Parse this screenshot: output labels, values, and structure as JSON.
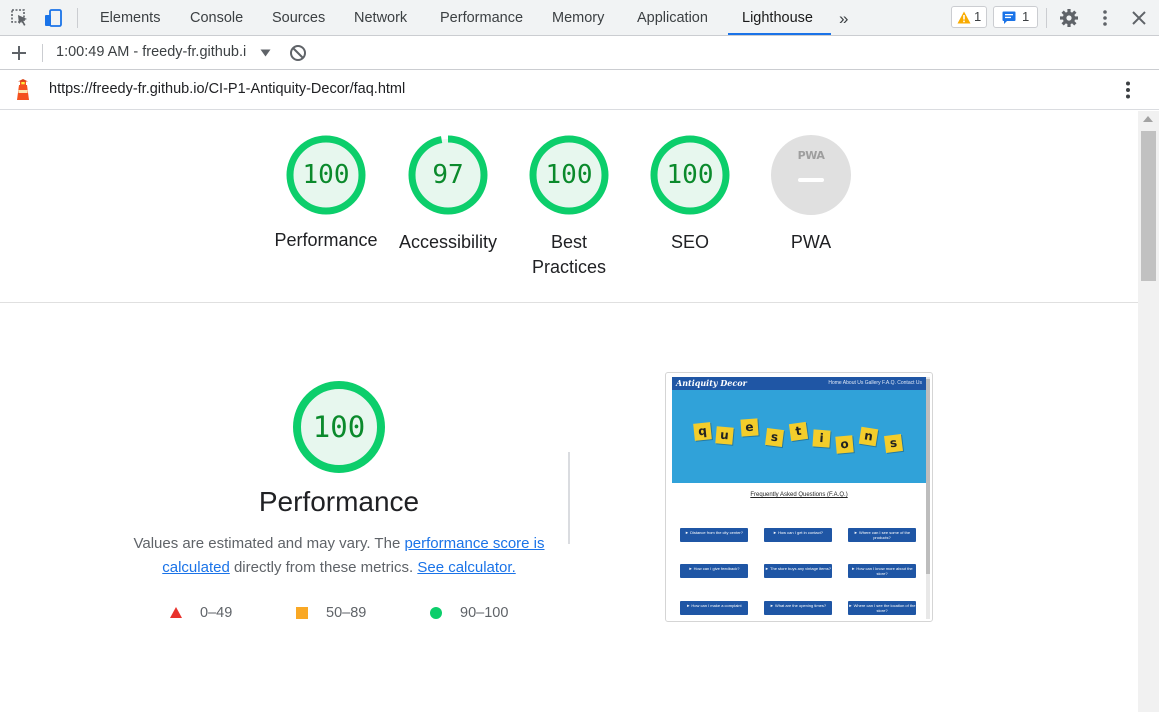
{
  "devtools": {
    "tabs": [
      {
        "label": "Elements"
      },
      {
        "label": "Console"
      },
      {
        "label": "Sources"
      },
      {
        "label": "Network"
      },
      {
        "label": "Performance"
      },
      {
        "label": "Memory"
      },
      {
        "label": "Application"
      },
      {
        "label": "Lighthouse"
      }
    ],
    "active_tab": "Lighthouse",
    "warning_count": "1",
    "message_count": "1"
  },
  "toolbar": {
    "report_selector": "1:00:49 AM - freedy-fr.github.i"
  },
  "report": {
    "url": "https://freedy-fr.github.io/CI-P1-Antiquity-Decor/faq.html"
  },
  "categories": [
    {
      "score": "100",
      "label": "Performance",
      "value": 1.0
    },
    {
      "score": "97",
      "label": "Accessibility",
      "value": 0.97
    },
    {
      "score": "100",
      "label": "Best Practices",
      "value": 1.0
    },
    {
      "score": "100",
      "label": "SEO",
      "value": 1.0
    },
    {
      "score": "",
      "label": "PWA",
      "badge": "PWA"
    }
  ],
  "performance": {
    "score": "100",
    "title": "Performance",
    "desc_prefix": "Values are estimated and may vary. The ",
    "score_link": "performance score is calculated",
    "desc_mid": " directly from these metrics. ",
    "calc_link": "See calculator.",
    "legend": [
      {
        "range": "0–49",
        "shape": "triangle",
        "color": "#e8322c"
      },
      {
        "range": "50–89",
        "shape": "square",
        "color": "#f9a825"
      },
      {
        "range": "90–100",
        "shape": "circle",
        "color": "#0cce6b"
      }
    ]
  },
  "thumbnail": {
    "brand": "Antiquity Decor",
    "nav_links": "Home  About Us  Gallery  F.A.Q.  Contact Us",
    "hero_letters": [
      "q",
      "u",
      "e",
      "s",
      "t",
      "i",
      "o",
      "n",
      "s"
    ],
    "heading": "Frequently Asked Questions (F.A.Q.)",
    "buttons": [
      "► Distance from the city center?",
      "► How can I get in contact?",
      "► Where can I see some of the products?",
      "► How can I give feedback?",
      "► The store buys any vintage items?",
      "► How can I know more about the store?",
      "► How can I make a complaint",
      "► What are the opening times?",
      "► Where can I see the location of the store?"
    ]
  },
  "colors": {
    "good": "#0cce6b",
    "good_text": "#0b8a2c",
    "good_fill": "#e7f7ee",
    "accent": "#1a73e8"
  }
}
